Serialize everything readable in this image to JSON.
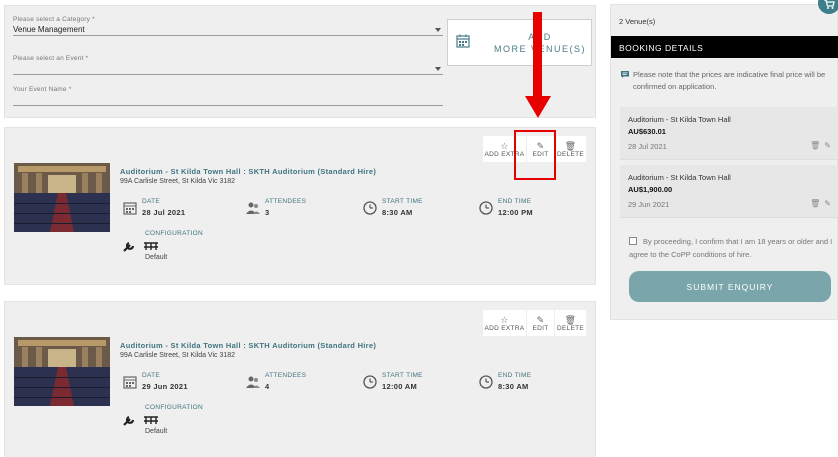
{
  "form": {
    "category_label": "Please select a Category *",
    "category_value": "Venue Management",
    "event_label": "Please select an Event *",
    "event_name_label": "Your Event Name *"
  },
  "add_more": {
    "line1": "ADD",
    "line2": "MORE VENUE(S)"
  },
  "cards": [
    {
      "title": "Auditorium - St Kilda Town Hall : SKTH Auditorium (Standard Hire)",
      "address": "99A Carlisle Street, St Kilda Vic 3182",
      "date_label": "DATE",
      "date": "28 Jul 2021",
      "attendees_label": "ATTENDEES",
      "attendees": "3",
      "start_label": "START TIME",
      "start": "8:30 AM",
      "end_label": "END TIME",
      "end": "12:00 PM",
      "config_label": "CONFIGURATION",
      "config": "Default",
      "add_extra": "ADD EXTRA",
      "edit": "EDIT",
      "delete": "DELETE"
    },
    {
      "title": "Auditorium - St Kilda Town Hall : SKTH Auditorium (Standard Hire)",
      "address": "99A Carlisle Street, St Kilda Vic 3182",
      "date_label": "DATE",
      "date": "29 Jun 2021",
      "attendees_label": "ATTENDEES",
      "attendees": "4",
      "start_label": "START TIME",
      "start": "12:00 AM",
      "end_label": "END TIME",
      "end": "8:30 AM",
      "config_label": "CONFIGURATION",
      "config": "Default",
      "add_extra": "ADD EXTRA",
      "edit": "EDIT",
      "delete": "DELETE"
    }
  ],
  "sidebar": {
    "venue_count": "2 Venue(s)",
    "header": "BOOKING DETAILS",
    "note": "Please note that the prices are indicative final price will be confirmed on application.",
    "bookings": [
      {
        "name": "Auditorium - St Kilda Town Hall",
        "price": "AU$630.01",
        "date": "28 Jul 2021"
      },
      {
        "name": "Auditorium - St Kilda Town Hall",
        "price": "AU$1,900.00",
        "date": "29 Jun 2021"
      }
    ],
    "agree": "By proceeding, I confirm that I am 18 years or older and I agree to the CoPP conditions of hire.",
    "submit": "SUBMIT ENQUIRY"
  },
  "icons": {
    "calendar": "calendar-icon",
    "attendees": "people-icon",
    "clock": "clock-icon",
    "wrench": "wrench-icon",
    "seating": "theatre-seating-icon",
    "star": "star-icon",
    "edit": "edit-icon",
    "trash": "trash-icon",
    "info": "info-icon",
    "cart": "cart-icon"
  },
  "colors": {
    "accent": "#3f7480",
    "header_bg": "#000000",
    "submit_bg": "#7aa5aa",
    "annotation": "#e60000"
  }
}
